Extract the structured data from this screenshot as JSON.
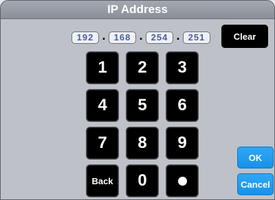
{
  "title": "IP Address",
  "ip": {
    "octets": [
      "192",
      "168",
      "254",
      "251"
    ],
    "separator": "."
  },
  "keypad": {
    "keys": [
      "1",
      "2",
      "3",
      "4",
      "5",
      "6",
      "7",
      "8",
      "9",
      "Back",
      "0"
    ]
  },
  "buttons": {
    "clear": "Clear",
    "ok": "OK",
    "cancel": "Cancel"
  },
  "colors": {
    "accent_blue": "#1a9bef",
    "key_black": "#000000",
    "panel": "#bfc1c8",
    "titlebar": "#979ba4"
  }
}
